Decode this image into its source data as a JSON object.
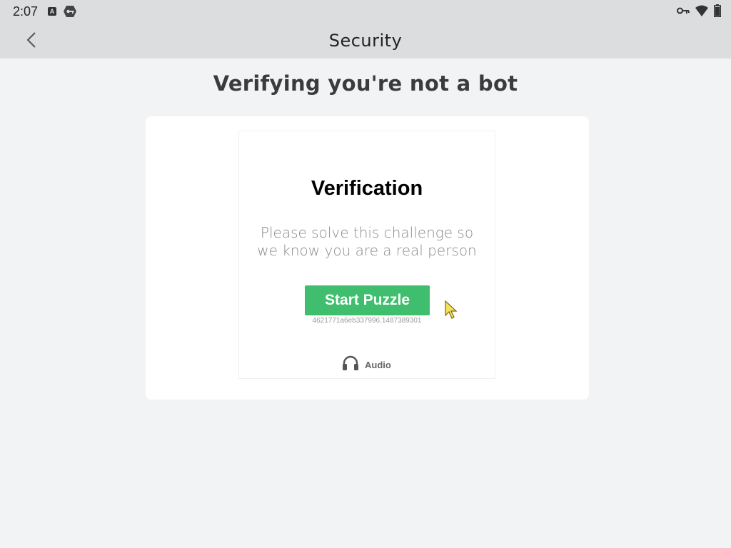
{
  "status_bar": {
    "time": "2:07",
    "left_icons": [
      "a-notification-icon",
      "key-notification-icon"
    ],
    "right_icons": [
      "vpn-key-icon",
      "wifi-icon",
      "battery-icon"
    ]
  },
  "app_bar": {
    "title": "Security",
    "back_icon": "chevron-left-icon"
  },
  "page": {
    "heading": "Verifying you're not a bot"
  },
  "challenge": {
    "title": "Verification",
    "description": "Please solve this challenge so we know you are a real person",
    "start_button_label": "Start Puzzle",
    "session_id": "4621771a6eb337996.1487389301",
    "audio_label": "Audio",
    "audio_icon": "headphones-icon",
    "button_color": "#3fbf6e"
  }
}
